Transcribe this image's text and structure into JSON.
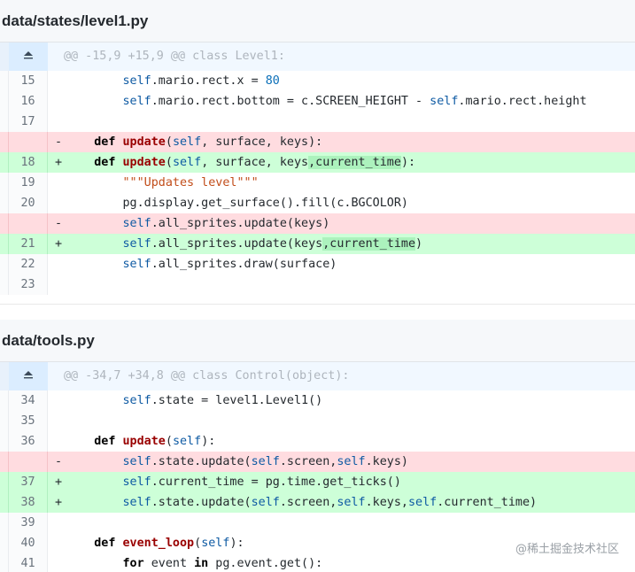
{
  "files": [
    {
      "title": "data/states/level1.py",
      "hunk": "@@ -15,9 +15,9 @@ class Level1:",
      "lines": [
        {
          "type": "ctx",
          "num": "15",
          "marker": "",
          "segs": [
            [
              "",
              "        "
            ],
            [
              "slf",
              "self"
            ],
            [
              "",
              ".mario.rect.x = "
            ],
            [
              "num",
              "80"
            ]
          ]
        },
        {
          "type": "ctx",
          "num": "16",
          "marker": "",
          "segs": [
            [
              "",
              "        "
            ],
            [
              "slf",
              "self"
            ],
            [
              "",
              ".mario.rect.bottom = c.SCREEN_HEIGHT - "
            ],
            [
              "slf",
              "self"
            ],
            [
              "",
              ".mario.rect.height"
            ]
          ]
        },
        {
          "type": "ctx",
          "num": "17",
          "marker": "",
          "segs": [
            [
              "",
              ""
            ]
          ]
        },
        {
          "type": "del",
          "num": "",
          "marker": "-",
          "segs": [
            [
              "",
              "    "
            ],
            [
              "kw",
              "def"
            ],
            [
              "",
              " "
            ],
            [
              "fn",
              "update"
            ],
            [
              "",
              "("
            ],
            [
              "slf",
              "self"
            ],
            [
              "",
              ", surface, keys):"
            ]
          ]
        },
        {
          "type": "add",
          "num": "18",
          "marker": "+",
          "segs": [
            [
              "",
              "    "
            ],
            [
              "kw",
              "def"
            ],
            [
              "",
              " "
            ],
            [
              "fn",
              "update"
            ],
            [
              "",
              "("
            ],
            [
              "slf",
              "self"
            ],
            [
              "",
              ", surface, keys"
            ],
            [
              "hl",
              ",current_time"
            ],
            [
              "",
              "):"
            ]
          ]
        },
        {
          "type": "ctx",
          "num": "19",
          "marker": "",
          "segs": [
            [
              "",
              "        "
            ],
            [
              "str",
              "\"\"\"Updates level\"\"\""
            ]
          ]
        },
        {
          "type": "ctx",
          "num": "20",
          "marker": "",
          "segs": [
            [
              "",
              "        pg.display.get_surface().fill(c.BGCOLOR)"
            ]
          ]
        },
        {
          "type": "del",
          "num": "",
          "marker": "-",
          "segs": [
            [
              "",
              "        "
            ],
            [
              "slf",
              "self"
            ],
            [
              "",
              ".all_sprites.update(keys)"
            ]
          ]
        },
        {
          "type": "add",
          "num": "21",
          "marker": "+",
          "segs": [
            [
              "",
              "        "
            ],
            [
              "slf",
              "self"
            ],
            [
              "",
              ".all_sprites.update(keys"
            ],
            [
              "hl",
              ",current_time"
            ],
            [
              "",
              ")"
            ]
          ]
        },
        {
          "type": "ctx",
          "num": "22",
          "marker": "",
          "segs": [
            [
              "",
              "        "
            ],
            [
              "slf",
              "self"
            ],
            [
              "",
              ".all_sprites.draw(surface)"
            ]
          ]
        },
        {
          "type": "ctx",
          "num": "23",
          "marker": "",
          "segs": [
            [
              "",
              ""
            ]
          ]
        }
      ]
    },
    {
      "title": "data/tools.py",
      "hunk": "@@ -34,7 +34,8 @@ class Control(object):",
      "lines": [
        {
          "type": "ctx",
          "num": "34",
          "marker": "",
          "segs": [
            [
              "",
              "        "
            ],
            [
              "slf",
              "self"
            ],
            [
              "",
              ".state = level1.Level1()"
            ]
          ]
        },
        {
          "type": "ctx",
          "num": "35",
          "marker": "",
          "segs": [
            [
              "",
              ""
            ]
          ]
        },
        {
          "type": "ctx",
          "num": "36",
          "marker": "",
          "segs": [
            [
              "",
              "    "
            ],
            [
              "kw",
              "def"
            ],
            [
              "",
              " "
            ],
            [
              "fn",
              "update"
            ],
            [
              "",
              "("
            ],
            [
              "slf",
              "self"
            ],
            [
              "",
              "):"
            ]
          ]
        },
        {
          "type": "del",
          "num": "",
          "marker": "-",
          "segs": [
            [
              "",
              "        "
            ],
            [
              "slf",
              "self"
            ],
            [
              "",
              ".state.update("
            ],
            [
              "slf",
              "self"
            ],
            [
              "",
              ".screen,"
            ],
            [
              "slf",
              "self"
            ],
            [
              "",
              ".keys)"
            ]
          ]
        },
        {
          "type": "add",
          "num": "37",
          "marker": "+",
          "segs": [
            [
              "",
              "        "
            ],
            [
              "slf",
              "self"
            ],
            [
              "",
              ".current_time = pg.time.get_ticks()"
            ]
          ]
        },
        {
          "type": "add",
          "num": "38",
          "marker": "+",
          "segs": [
            [
              "",
              "        "
            ],
            [
              "slf",
              "self"
            ],
            [
              "",
              ".state.update("
            ],
            [
              "slf",
              "self"
            ],
            [
              "",
              ".screen,"
            ],
            [
              "slf",
              "self"
            ],
            [
              "",
              ".keys,"
            ],
            [
              "slf",
              "self"
            ],
            [
              "",
              ".current_time)"
            ]
          ]
        },
        {
          "type": "ctx",
          "num": "39",
          "marker": "",
          "segs": [
            [
              "",
              ""
            ]
          ]
        },
        {
          "type": "ctx",
          "num": "40",
          "marker": "",
          "segs": [
            [
              "",
              "    "
            ],
            [
              "kw",
              "def"
            ],
            [
              "",
              " "
            ],
            [
              "fn",
              "event_loop"
            ],
            [
              "",
              "("
            ],
            [
              "slf",
              "self"
            ],
            [
              "",
              "):"
            ]
          ]
        },
        {
          "type": "ctx",
          "num": "41",
          "marker": "",
          "segs": [
            [
              "",
              "        "
            ],
            [
              "kw",
              "for"
            ],
            [
              "",
              " event "
            ],
            [
              "kw",
              "in"
            ],
            [
              "",
              " pg.event.get():"
            ]
          ]
        }
      ]
    }
  ],
  "icons": {
    "expand": "expand-up-icon"
  },
  "watermark": "@稀土掘金技术社区"
}
